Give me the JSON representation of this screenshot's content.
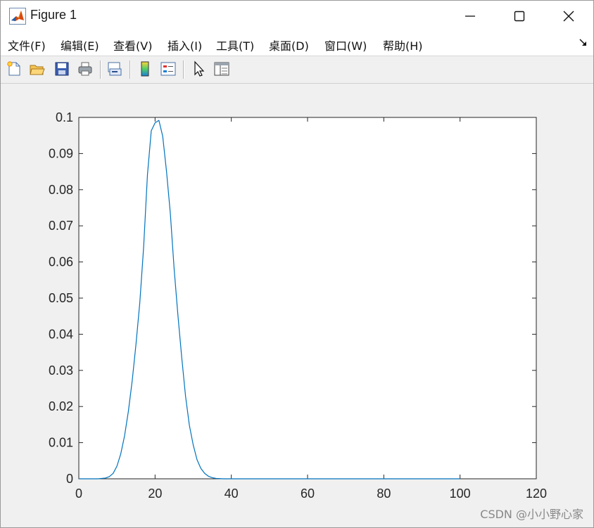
{
  "window": {
    "title": "Figure 1",
    "minimize_label": "—",
    "maximize_label": "☐",
    "close_label": "✕"
  },
  "menu": {
    "items": [
      "文件(F)",
      "编辑(E)",
      "查看(V)",
      "插入(I)",
      "工具(T)",
      "桌面(D)",
      "窗口(W)",
      "帮助(H)"
    ],
    "dock_icon": "dock-arrow-icon"
  },
  "toolbar": {
    "icons": [
      "new-figure-icon",
      "open-file-icon",
      "save-icon",
      "print-icon",
      "link-plot-icon",
      "colorbar-icon",
      "legend-icon",
      "pointer-icon",
      "property-inspector-icon"
    ]
  },
  "watermark": "CSDN @小小野心家",
  "chart_data": {
    "type": "line",
    "title": "",
    "xlabel": "",
    "ylabel": "",
    "xlim": [
      0,
      120
    ],
    "ylim": [
      0,
      0.1
    ],
    "xticks": [
      "0",
      "20",
      "40",
      "60",
      "80",
      "100",
      "120"
    ],
    "yticks": [
      "0",
      "0.01",
      "0.02",
      "0.03",
      "0.04",
      "0.05",
      "0.06",
      "0.07",
      "0.08",
      "0.09",
      "0.1"
    ],
    "grid": false,
    "line_color": "#0072bd",
    "series": [
      {
        "x": [
          0,
          1,
          2,
          3,
          4,
          5,
          6,
          7,
          8,
          9,
          10,
          11,
          12,
          13,
          14,
          15,
          16,
          17,
          18,
          19,
          20,
          21,
          22,
          23,
          24,
          25,
          26,
          27,
          28,
          29,
          30,
          31,
          32,
          33,
          34,
          35,
          36,
          37,
          38,
          39,
          40,
          45,
          50,
          60,
          70,
          80,
          90,
          100
        ],
        "values": [
          0,
          0,
          0,
          0,
          0,
          0,
          0.0001,
          0.0002,
          0.0006,
          0.0015,
          0.0035,
          0.0069,
          0.0119,
          0.0187,
          0.0271,
          0.0373,
          0.0488,
          0.0641,
          0.0841,
          0.0963,
          0.0985,
          0.0992,
          0.0948,
          0.0851,
          0.0735,
          0.0581,
          0.0452,
          0.0335,
          0.0228,
          0.0148,
          0.0094,
          0.0053,
          0.0029,
          0.0015,
          0.0007,
          0.0003,
          0.0001,
          5e-05,
          0,
          0,
          0,
          0,
          0,
          0,
          0,
          0,
          0,
          0
        ]
      }
    ]
  }
}
